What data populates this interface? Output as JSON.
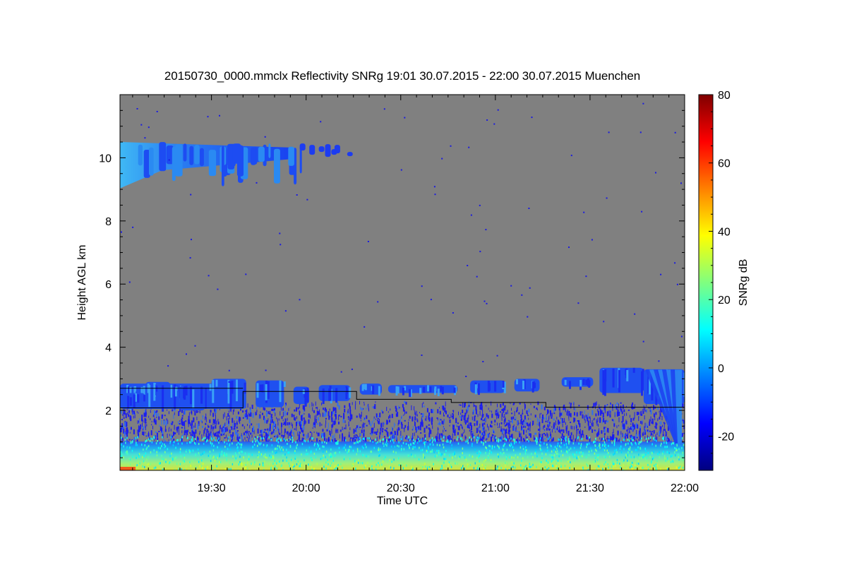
{
  "chart_data": {
    "type": "heatmap",
    "title": "20150730_0000.mmclx Reflectivity SNRg   19:01 30.07.2015 - 22:00 30.07.2015 Muenchen",
    "xlabel": "Time UTC",
    "ylabel": "Height AGL km",
    "x_ticks": [
      "19:30",
      "20:00",
      "20:30",
      "21:00",
      "21:30",
      "22:00"
    ],
    "x_range": [
      "19:01",
      "22:00"
    ],
    "y_ticks": [
      2,
      4,
      6,
      8,
      10
    ],
    "y_range": [
      0.1,
      12.0
    ],
    "colorbar": {
      "label": "SNRg dB",
      "ticks": [
        -20,
        0,
        20,
        40,
        60,
        80
      ],
      "range": [
        -30,
        80
      ],
      "colormap": "jet"
    },
    "background_color": "#808080",
    "features": [
      {
        "name": "surface-echo",
        "start": "19:01",
        "end": "22:00",
        "height_km": [
          0.1,
          1.1
        ],
        "snr_db": [
          5,
          40
        ]
      },
      {
        "name": "boundary-layer-clutter",
        "start": "19:01",
        "end": "22:00",
        "height_km": [
          0.9,
          2.3
        ],
        "snr_db": [
          -25,
          -10
        ]
      },
      {
        "name": "cirrus-layer",
        "start": "19:01",
        "end": "20:12",
        "height_km": [
          8.9,
          10.5
        ],
        "snr_db": [
          -15,
          10
        ]
      },
      {
        "name": "low-cloud-layer",
        "start": "19:01",
        "end": "22:00",
        "height_km": [
          2.0,
          3.4
        ],
        "snr_db": [
          -15,
          5
        ]
      },
      {
        "name": "fall-streak",
        "start": "21:43",
        "end": "22:00",
        "height_km": [
          1.0,
          3.4
        ],
        "snr_db": [
          -10,
          5
        ]
      }
    ],
    "overlay_line_lower": [
      {
        "time": "19:01",
        "height_km": 2.08
      },
      {
        "time": "19:40",
        "height_km": 2.08
      },
      {
        "time": "19:40",
        "height_km": 2.6
      },
      {
        "time": "20:16",
        "height_km": 2.6
      },
      {
        "time": "20:16",
        "height_km": 2.35
      },
      {
        "time": "20:46",
        "height_km": 2.35
      },
      {
        "time": "20:46",
        "height_km": 2.25
      },
      {
        "time": "21:16",
        "height_km": 2.25
      },
      {
        "time": "21:16",
        "height_km": 2.1
      },
      {
        "time": "22:00",
        "height_km": 2.1
      }
    ],
    "overlay_line_upper": [
      {
        "time": "19:01",
        "height_km": 2.7
      },
      {
        "time": "19:40",
        "height_km": 2.7
      }
    ]
  }
}
